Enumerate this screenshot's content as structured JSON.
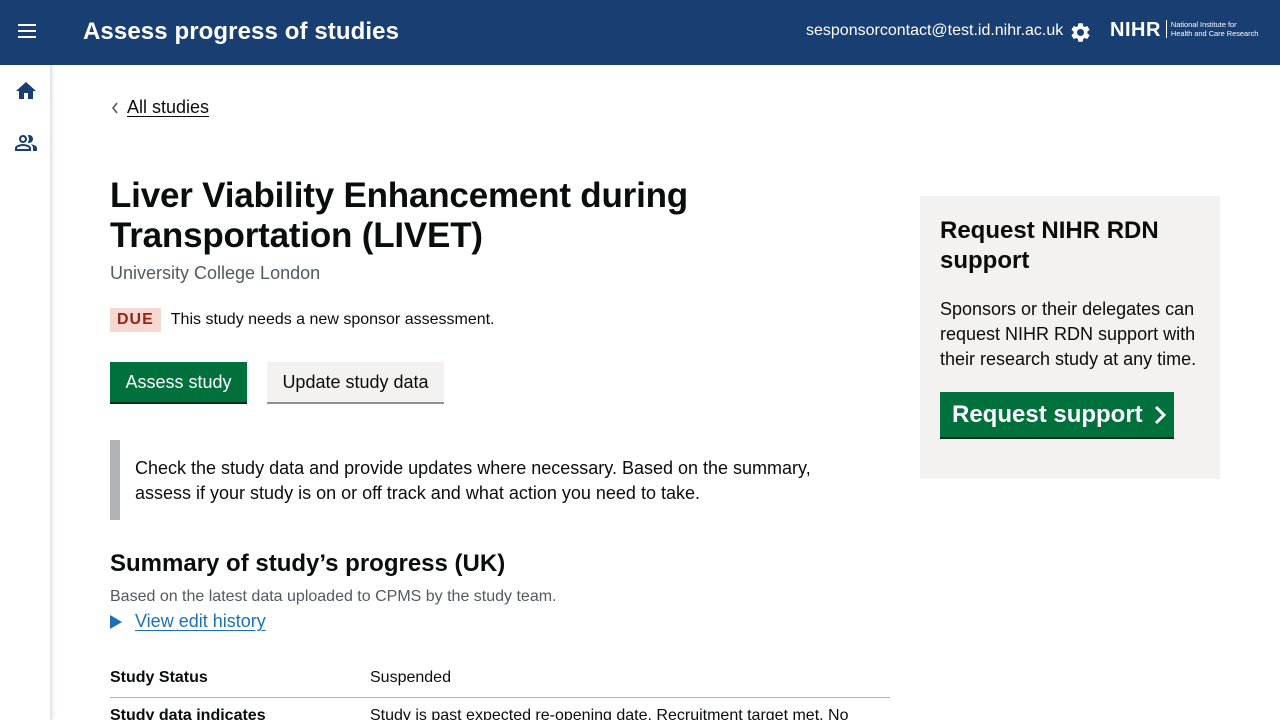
{
  "header": {
    "app_title": "Assess progress of studies",
    "user_email": "sesponsorcontact@test.id.nihr.ac.uk",
    "logo_mark": "NIHR",
    "logo_text_line1": "National Institute for",
    "logo_text_line2": "Health and Care Research",
    "menu_icon": "hamburger-menu-icon",
    "settings_icon": "gear-icon"
  },
  "sidebar": {
    "items": [
      {
        "icon": "home-icon",
        "label": "Home"
      },
      {
        "icon": "users-icon",
        "label": "Users"
      }
    ]
  },
  "breadcrumb": {
    "back_label": "All studies"
  },
  "study": {
    "title": "Liver Viability Enhancement during Transportation (LIVET)",
    "organisation": "University College London",
    "status_tag": "DUE",
    "status_message": "This study needs a new sponsor assessment."
  },
  "actions": {
    "assess_label": "Assess study",
    "update_label": "Update study data"
  },
  "inset_text": "Check the study data and provide updates where necessary. Based on the summary, assess if your study is on or off track and what action you need to take.",
  "summary": {
    "heading": "Summary of study’s progress (UK)",
    "subtext": "Based on the latest data uploaded to CPMS by the study team.",
    "history_link": "View edit history",
    "rows": [
      {
        "key": "Study Status",
        "value": "Suspended"
      },
      {
        "key": "Study data indicates",
        "value": "Study is past expected re-opening date. Recruitment target met. No"
      }
    ]
  },
  "support_panel": {
    "title": "Request NIHR RDN support",
    "text": "Sponsors or their delegates can request NIHR RDN support with their research study at any time.",
    "button_label": "Request support"
  },
  "colors": {
    "header_bg": "#193e72",
    "primary_green": "#00703c",
    "link_blue": "#1d70b8",
    "due_tag_bg": "#f6d7d2",
    "due_tag_text": "#942514"
  }
}
